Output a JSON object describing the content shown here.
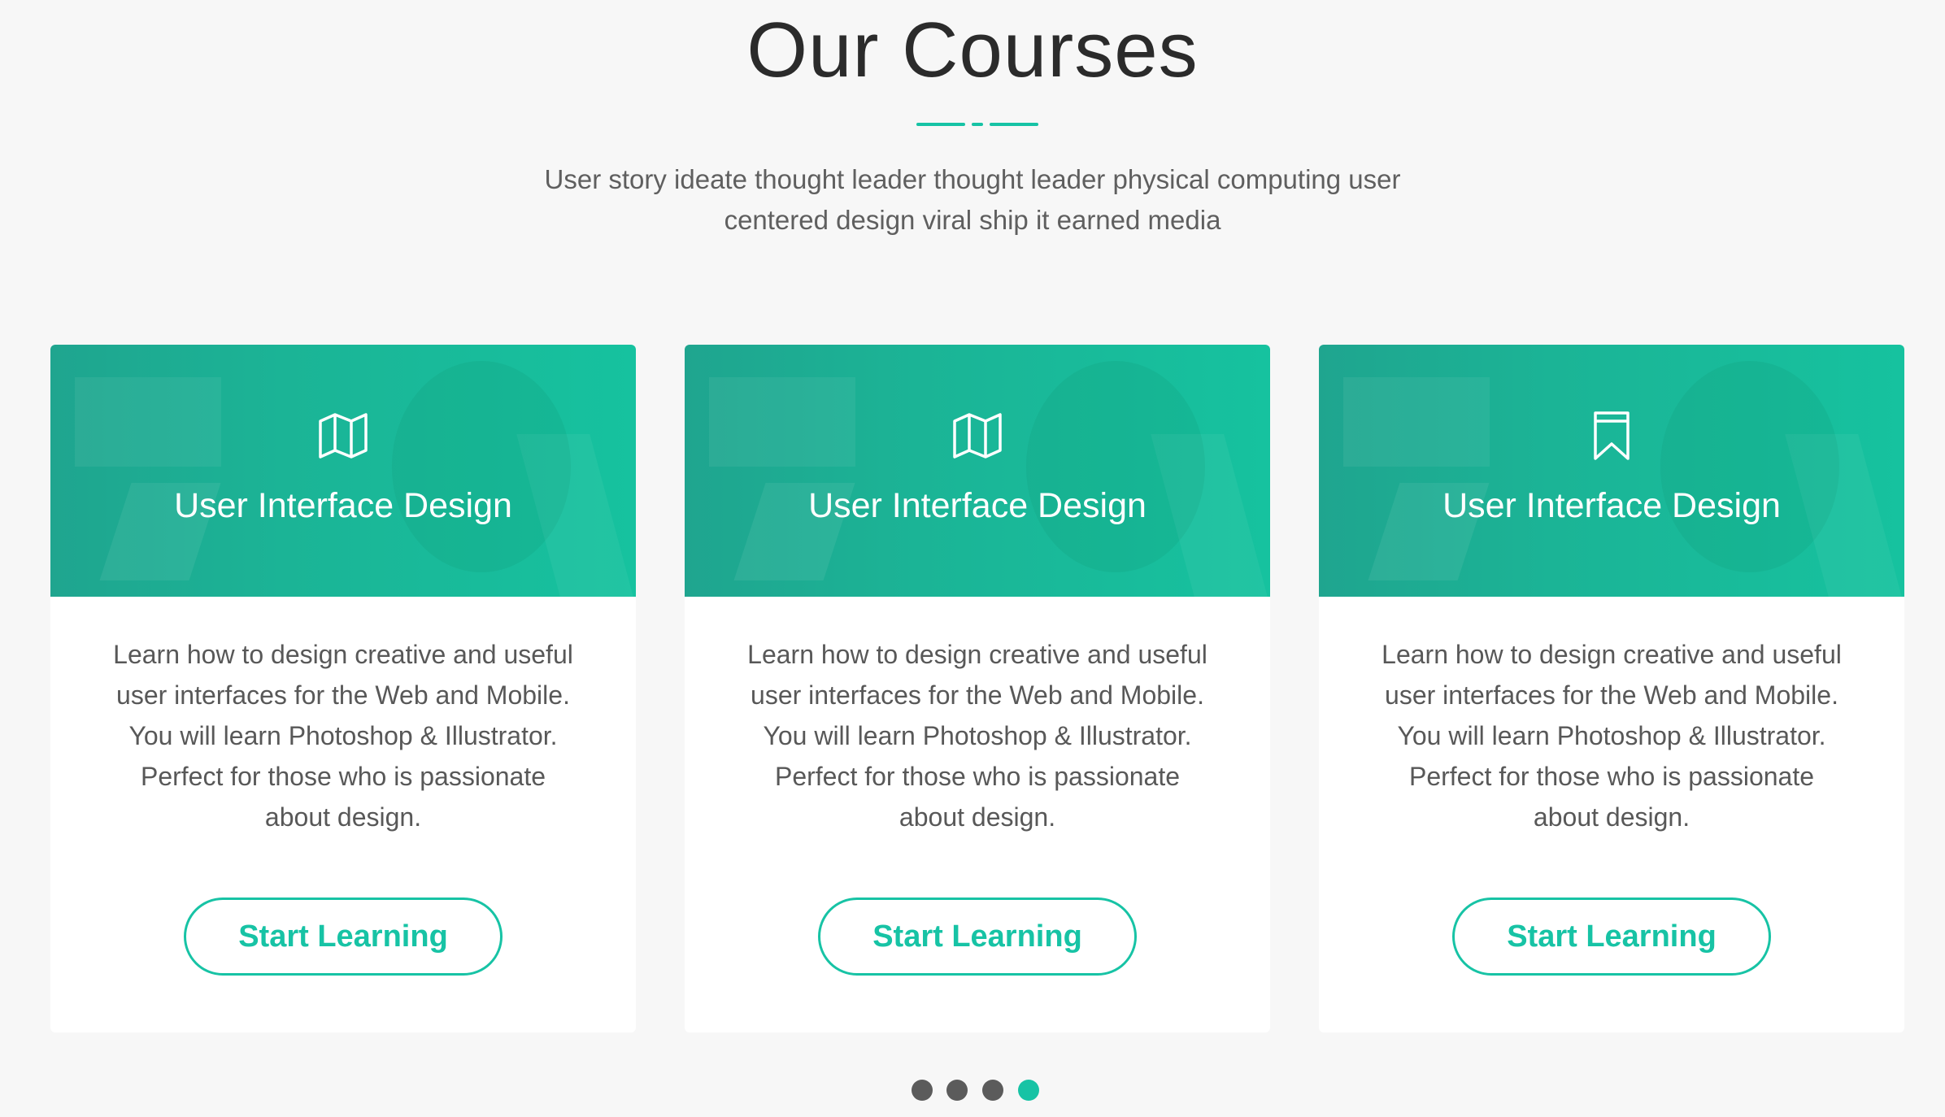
{
  "section": {
    "title": "Our Courses",
    "subtitle_line1": "User story ideate thought leader thought leader physical computing user",
    "subtitle_line2": "centered design viral ship it earned media"
  },
  "colors": {
    "accent": "#17c3a5",
    "background": "#f7f7f7",
    "title_text": "#2b2b2b",
    "body_text": "#585858",
    "dot_inactive": "#5b5b5b"
  },
  "courses": [
    {
      "icon": "map-icon",
      "title": "User Interface Design",
      "description_lines": [
        "Learn how to design creative and useful",
        "user interfaces for the Web and Mobile.",
        "You will learn Photoshop & Illustrator.",
        "Perfect for those who is passionate",
        "about design."
      ],
      "button_label": "Start Learning"
    },
    {
      "icon": "map-icon",
      "title": "User Interface Design",
      "description_lines": [
        "Learn how to design creative and useful",
        "user interfaces for the Web and Mobile.",
        "You will learn Photoshop & Illustrator.",
        "Perfect for those who is passionate",
        "about design."
      ],
      "button_label": "Start Learning"
    },
    {
      "icon": "bookmark-icon",
      "title": "User Interface Design",
      "description_lines": [
        "Learn how to design creative and useful",
        "user interfaces for the Web and Mobile.",
        "You will learn Photoshop & Illustrator.",
        "Perfect for those who is passionate",
        "about design."
      ],
      "button_label": "Start Learning"
    }
  ],
  "pagination": {
    "total": 4,
    "active_index": 3
  }
}
